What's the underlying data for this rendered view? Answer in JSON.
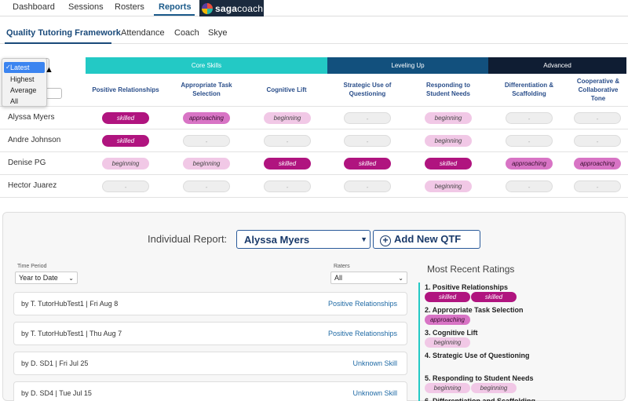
{
  "top_tabs": [
    "Dashboard",
    "Sessions",
    "Rosters",
    "Reports"
  ],
  "brand": {
    "part1": "saga",
    "part2": "coach"
  },
  "sub_tabs": [
    "Quality Tutoring Framework",
    "Attendance",
    "Coach",
    "Skye"
  ],
  "view_menu": {
    "options": [
      "Latest",
      "Highest",
      "Average",
      "All"
    ],
    "selected": "Latest"
  },
  "groups": {
    "core": "Core Skills",
    "level": "Leveling Up",
    "adv": "Advanced"
  },
  "skills": [
    "Positive Relationships",
    "Appropriate Task Selection",
    "Cognitive Lift",
    "Strategic Use of Questioning",
    "Responding to Student Needs",
    "Differentiation & Scaffolding",
    "Cooperative & Collaborative Tone"
  ],
  "rows": [
    {
      "name": "Alyssa Myers",
      "ratings": [
        "skilled",
        "approaching",
        "beginning",
        "-",
        "beginning",
        "-",
        "-"
      ]
    },
    {
      "name": "Andre Johnson",
      "ratings": [
        "skilled",
        "-",
        "-",
        "-",
        "beginning",
        "-",
        "-"
      ]
    },
    {
      "name": "Denise PG",
      "ratings": [
        "beginning",
        "beginning",
        "skilled",
        "skilled",
        "skilled",
        "approaching",
        "approaching"
      ]
    },
    {
      "name": "Hector Juarez",
      "ratings": [
        "-",
        "-",
        "-",
        "-",
        "beginning",
        "-",
        "-"
      ]
    }
  ],
  "individual": {
    "label": "Individual Report:",
    "selected": "Alyssa Myers",
    "add_label": "Add New QTF",
    "time_period_label": "Time Period",
    "time_period": "Year to Date",
    "raters_label": "Raters",
    "raters": "All"
  },
  "reports": [
    {
      "who": "by T. TutorHubTest1  |  Fri Aug 8",
      "skill": "Positive Relationships"
    },
    {
      "who": "by T. TutorHubTest1  |  Thu Aug 7",
      "skill": "Positive Relationships"
    },
    {
      "who": "by D. SD1  |  Fri Jul 25",
      "skill": "Unknown Skill"
    },
    {
      "who": "by D. SD4  |  Tue Jul 15",
      "skill": "Unknown Skill"
    }
  ],
  "recent": {
    "title": "Most Recent Ratings",
    "items": [
      {
        "label": "1. Positive Relationships",
        "ratings": [
          "skilled",
          "skilled"
        ]
      },
      {
        "label": "2. Appropriate Task Selection",
        "ratings": [
          "approaching"
        ]
      },
      {
        "label": "3. Cognitive Lift",
        "ratings": [
          "beginning"
        ]
      },
      {
        "label": "4. Strategic Use of Questioning",
        "ratings": []
      },
      {
        "label": "5. Responding to Student Needs",
        "ratings": [
          "beginning",
          "beginning"
        ]
      },
      {
        "label": "6. Differentiation and Scaffolding",
        "ratings": []
      }
    ]
  },
  "colors": {
    "skilled": "#b0147f",
    "approaching": "#d874c5",
    "beginning": "#f1c8e6",
    "core": "#23c9c5",
    "level": "#12507d",
    "adv": "#0f1d33"
  }
}
